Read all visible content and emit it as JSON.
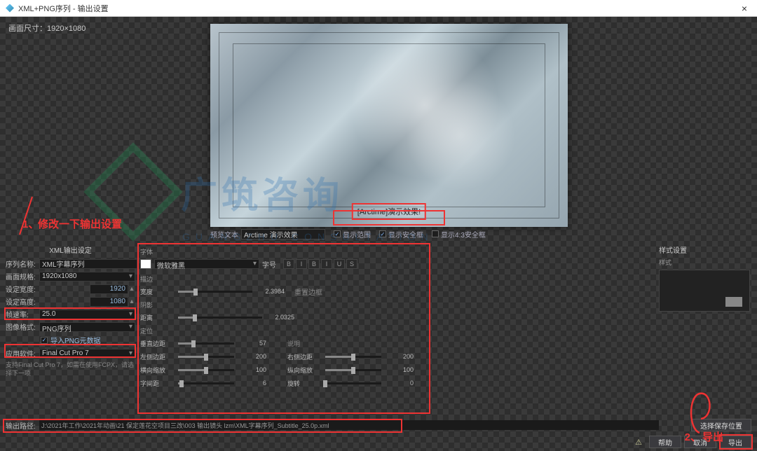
{
  "window": {
    "title": "XML+PNG序列 - 输出设置",
    "close": "×"
  },
  "dim_label": "画面尺寸：1920×1080",
  "subtitle_sample": "[Arctime]演示效果!",
  "preview_bar": {
    "label": "预览文本",
    "value": "Arctime 演示效果",
    "chk1": "显示范围",
    "chk2": "显示安全框",
    "chk3": "显示4:3安全框"
  },
  "left": {
    "title": "XML输出设定",
    "seq_name_l": "序列名称:",
    "seq_name": "XML字幕序列",
    "res_l": "画面规格:",
    "res": "1920x1080",
    "w_l": "设定宽度:",
    "w": "1920",
    "h_l": "设定高度:",
    "h": "1080",
    "fps_l": "帧速率:",
    "fps": "25.0",
    "fmt_l": "图像格式:",
    "fmt": "PNG序列",
    "chk_embed": "导入PNG元数据",
    "app_l": "应用软件:",
    "app": "Final Cut Pro 7",
    "hint": "支持Final Cut Pro 7，如需在使用FCPX，请选择下一项"
  },
  "mid": {
    "font_title": "字体",
    "font_name": "微软雅黑",
    "size_l": "字号",
    "tools": [
      "B",
      "I",
      "B",
      "I",
      "U",
      "S"
    ],
    "stroke": "描边",
    "stroke_w_l": "宽度",
    "stroke_w": "2.3984",
    "stroke_reset": "重置边框",
    "shadow": "阴影",
    "shadow_d_l": "距离",
    "shadow_d": "2.0325",
    "pos": "定位",
    "pos_title": "说明",
    "s1": {
      "l": "垂直边距",
      "v": "57"
    },
    "s2": {
      "l": "左侧边距",
      "v": "200"
    },
    "s3": {
      "l": "右侧边距",
      "v": "200"
    },
    "s4": {
      "l": "横向缩放",
      "v": "100"
    },
    "s5": {
      "l": "纵向缩放",
      "v": "100"
    },
    "s6": {
      "l": "字间距",
      "v": "6"
    },
    "s7": {
      "l": "旋转",
      "v": "0"
    }
  },
  "right_title": "样式设置",
  "style_title": "样式",
  "output": {
    "l": "输出路径:",
    "v": "J:\\2021年工作\\2021年动画\\21 保定莲花空项目三改\\003 输出镜头 lzm\\XML字幕序列_Subtitle_25.0p.xml"
  },
  "buttons": {
    "save_loc": "选择保存位置",
    "help": "帮助",
    "cancel": "取消",
    "export": "导出"
  },
  "annotations": {
    "a1": "修改一下输出设置",
    "a2": "导出",
    "n1": "1、",
    "n2": "2、"
  },
  "watermark": {
    "txt": "广筑咨询",
    "sub": "GUANGZHU CONSULTATION"
  }
}
